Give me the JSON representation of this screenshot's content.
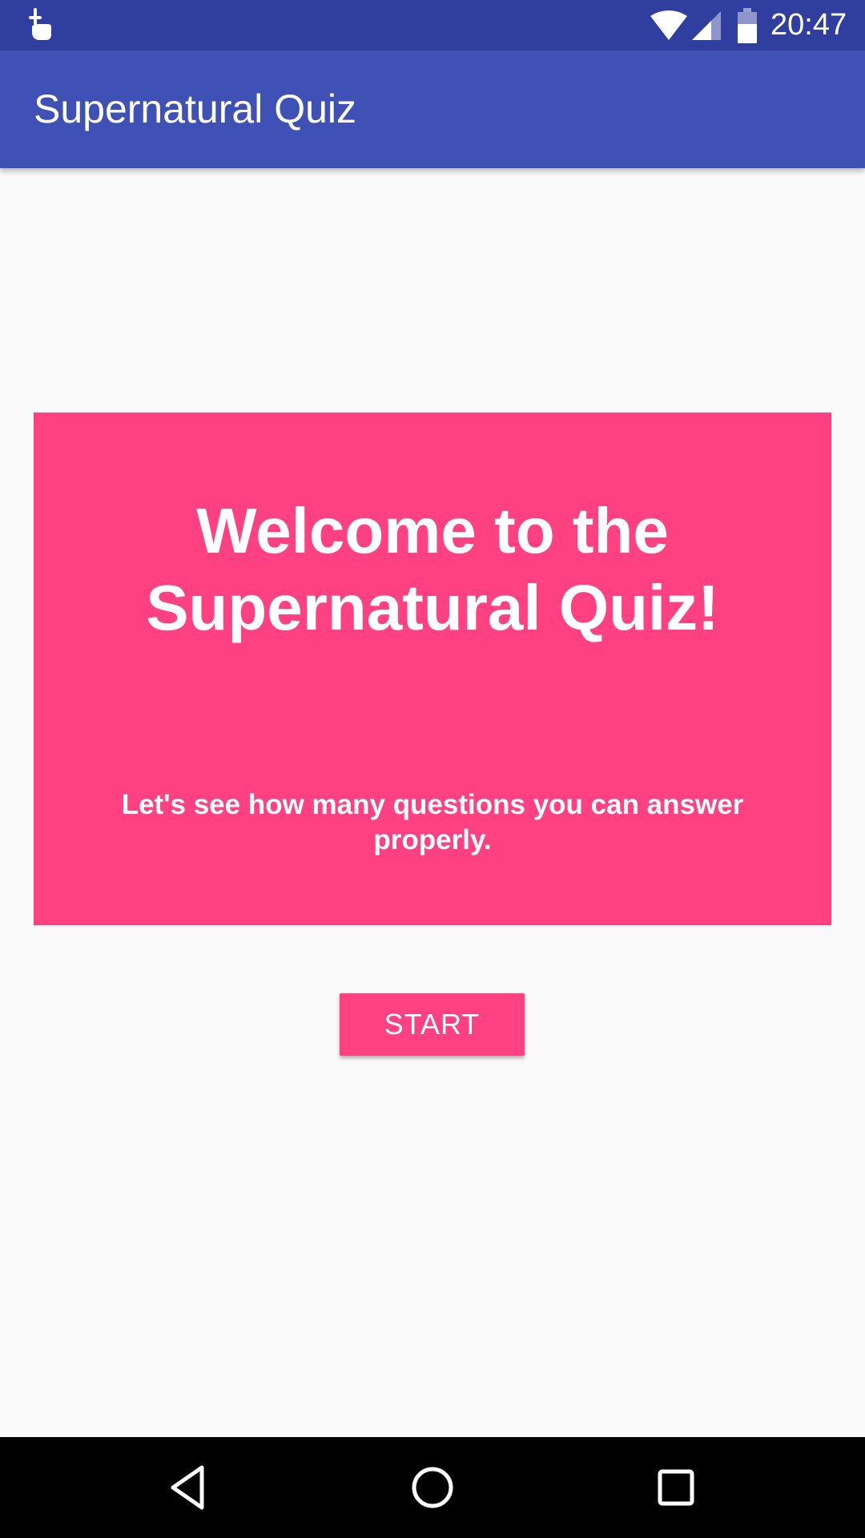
{
  "status_bar": {
    "time": "20:47",
    "icons": [
      "touch-notification-icon",
      "wifi-icon",
      "cell-signal-icon",
      "battery-icon"
    ]
  },
  "app_bar": {
    "title": "Supernatural Quiz",
    "color": "#3f51b5"
  },
  "welcome": {
    "headline": "Welcome to the Supernatural Quiz!",
    "subtitle": "Let's see how many questions you can answer properly.",
    "color": "#ff4081"
  },
  "start_button": {
    "label": "START"
  },
  "nav_bar": {
    "icons": [
      "back-icon",
      "home-icon",
      "recents-icon"
    ]
  },
  "colors": {
    "status_bar": "#303f9f",
    "accent": "#ff4081",
    "background": "#fafafa"
  }
}
